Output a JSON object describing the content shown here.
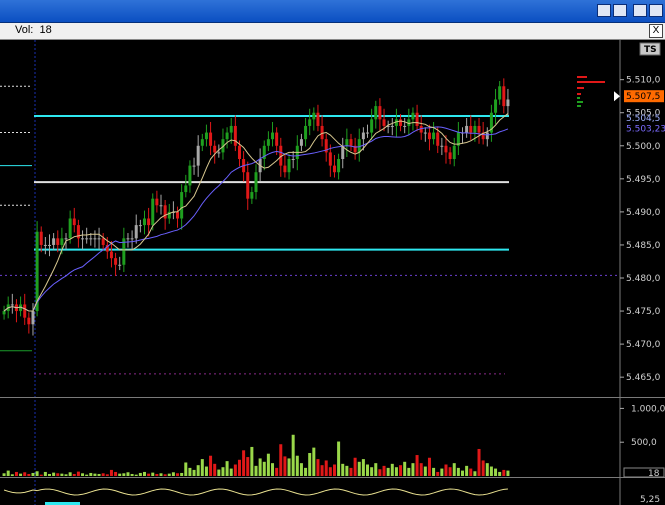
{
  "window": {
    "vol_label": "Vol:",
    "vol_value": "18",
    "close_label": "X",
    "ts_badge": "TS"
  },
  "chart_data": [
    {
      "type": "candlestick",
      "title": "",
      "ylim": [
        5462,
        5516
      ],
      "y_ticks": [
        5510,
        5505,
        5500,
        5495,
        5490,
        5485,
        5480,
        5475,
        5470,
        5465
      ],
      "y_tick_labels": [
        "5.510,0",
        "5.505,0",
        "5.500,0",
        "5.495,0",
        "5.490,0",
        "5.485,0",
        "5.480,0",
        "5.475,0",
        "5.470,0",
        "5.465,0"
      ],
      "price_labels": [
        {
          "label": "5.507,5",
          "value": 5507.5,
          "color": "#ff6a00"
        },
        {
          "label": "5.504,5",
          "value": 5504.5,
          "color": "#9fb0ff"
        },
        {
          "label": "5.503,23",
          "value": 5503.23,
          "color": "#7b6bff"
        }
      ],
      "horizontal_levels": [
        {
          "value": 5504.5,
          "color": "#2ee8f0"
        },
        {
          "value": 5494.5,
          "color": "#e0e0e0"
        },
        {
          "value": 5484.3,
          "color": "#2ee8f0"
        },
        {
          "value": 5480.4,
          "color": "#6b3fd0",
          "style": "dotted"
        },
        {
          "value": 5465.5,
          "color": "#8a2b8a",
          "style": "dotted"
        }
      ],
      "close": [
        5475,
        5476,
        5476,
        5475,
        5476,
        5474,
        5473,
        5475,
        5487,
        5485,
        5485,
        5485,
        5486,
        5485,
        5486,
        5486,
        5489,
        5488,
        5486,
        5486,
        5486,
        5486,
        5486,
        5486,
        5485,
        5484,
        5483,
        5482,
        5482,
        5486,
        5486,
        5486,
        5488,
        5488,
        5489,
        5488,
        5492,
        5491,
        5491,
        5489,
        5490,
        5490,
        5489,
        5493,
        5494,
        5497,
        5497,
        5500,
        5501,
        5502,
        5500,
        5499,
        5499,
        5501,
        5502,
        5503,
        5500,
        5498,
        5496,
        5492,
        5493,
        5496,
        5498,
        5500,
        5501,
        5502,
        5500,
        5497,
        5496,
        5498,
        5498,
        5500,
        5501,
        5503,
        5504,
        5505,
        5503,
        5501,
        5499,
        5497,
        5496,
        5498,
        5500,
        5501,
        5500,
        5499,
        5501,
        5502,
        5502,
        5504,
        5506,
        5504,
        5503,
        5503,
        5503,
        5504,
        5503,
        5503,
        5504,
        5505,
        5503,
        5502,
        5502,
        5501,
        5502,
        5500,
        5500,
        5499,
        5498,
        5500,
        5502,
        5502,
        5503,
        5502,
        5503,
        5502,
        5501,
        5502,
        5505,
        5507,
        5509,
        5506,
        5507
      ]
    },
    {
      "type": "bar",
      "series": [
        {
          "values": [
            40,
            80,
            25,
            60,
            35,
            55,
            30,
            45,
            70,
            20,
            60,
            30,
            50,
            40,
            35,
            25,
            55,
            30,
            65,
            40,
            20,
            45,
            35,
            30,
            40,
            25,
            90,
            60,
            35,
            40,
            55,
            30,
            20,
            45,
            60,
            35,
            50,
            30,
            40,
            25,
            35,
            55,
            40,
            45,
            200,
            120,
            90,
            160,
            250,
            140,
            300,
            180,
            95,
            130,
            220,
            110,
            170,
            240,
            380,
            280,
            430,
            150,
            260,
            210,
            330,
            190,
            120,
            470,
            290,
            260,
            610,
            300,
            190,
            120,
            340,
            420,
            250,
            160,
            230,
            130,
            170,
            510,
            180,
            150,
            120,
            270,
            210,
            250,
            170,
            130,
            190,
            100,
            150,
            120,
            180,
            130,
            160,
            210,
            120,
            190,
            310,
            190,
            140,
            270,
            120,
            60,
            110,
            170,
            130,
            190,
            120,
            80,
            150,
            110,
            70,
            400,
            230,
            190,
            140,
            110,
            60,
            90,
            80
          ]
        }
      ],
      "y_tick_labels": [
        "1.000,0",
        "500,0"
      ],
      "last_value": "18"
    },
    {
      "type": "line",
      "last_value": "5,25"
    }
  ]
}
